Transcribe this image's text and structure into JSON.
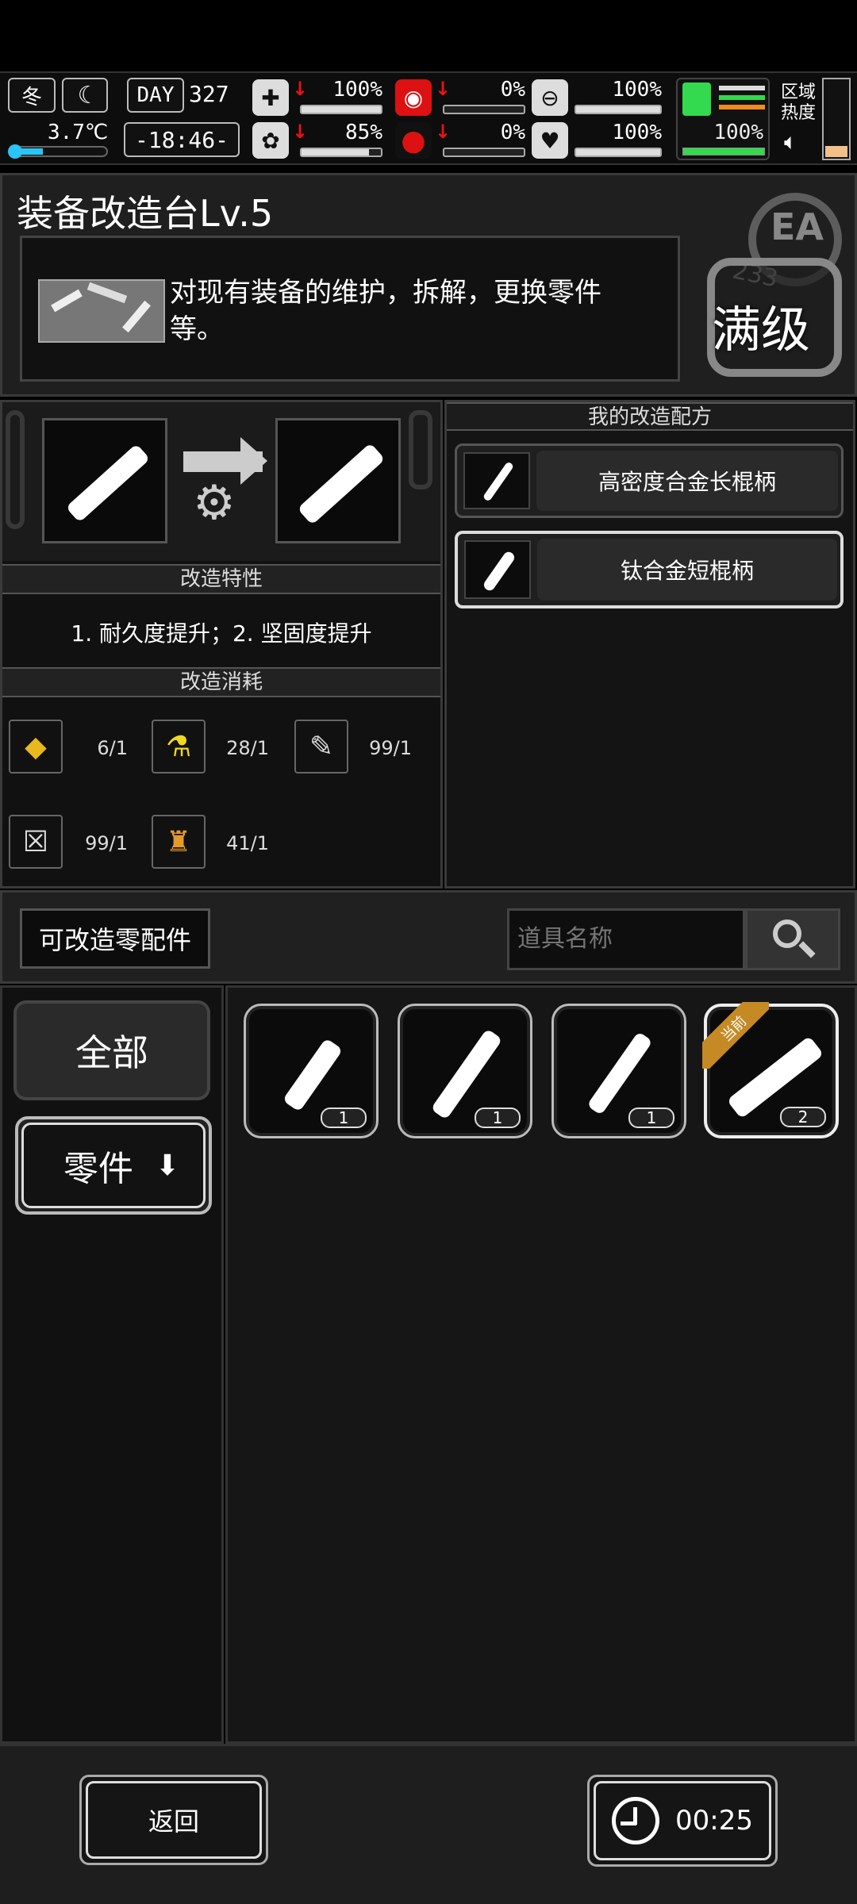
{
  "status": {
    "season": "冬",
    "day_label": "DAY",
    "day": "327",
    "temperature": "3.7℃",
    "time": "-18:46-",
    "stats": [
      {
        "name": "health",
        "value": "100%",
        "fraction": 1.0
      },
      {
        "name": "hunger",
        "value": "0%",
        "fraction": 0.0
      },
      {
        "name": "stomach",
        "value": "100%",
        "fraction": 1.0
      },
      {
        "name": "sanity",
        "value": "85%",
        "fraction": 0.85
      },
      {
        "name": "thirst",
        "value": "0%",
        "fraction": 0.0
      },
      {
        "name": "heart",
        "value": "100%",
        "fraction": 1.0
      }
    ],
    "stamina": "100%",
    "zone_heat_label_1": "区域",
    "zone_heat_label_2": "热度"
  },
  "title": {
    "name": "装备改造台Lv.5",
    "description": "对现有装备的维护，拆解，更换零件等。",
    "badge_top": "EA",
    "badge_mid": "233",
    "max_level": "满级"
  },
  "upgrade": {
    "traits_header": "改造特性",
    "traits_text": "1. 耐久度提升；2. 坚固度提升",
    "cost_header": "改造消耗",
    "costs": [
      {
        "icon": "fuel-icon",
        "value": "6/1"
      },
      {
        "icon": "flask-icon",
        "value": "28/1"
      },
      {
        "icon": "syringe-icon",
        "value": "99/1"
      },
      {
        "icon": "battery-icon",
        "value": "99/1"
      },
      {
        "icon": "potion-icon",
        "value": "41/1"
      }
    ]
  },
  "recipes": {
    "header": "我的改造配方",
    "items": [
      {
        "label": "高密度合金长棍柄"
      },
      {
        "label": "钛合金短棍柄"
      }
    ]
  },
  "parts": {
    "section_label": "可改造零配件",
    "search_placeholder": "道具名称",
    "filter_all": "全部",
    "filter_parts": "零件",
    "items": [
      {
        "count": "1"
      },
      {
        "count": "1"
      },
      {
        "count": "1"
      },
      {
        "count": "2",
        "tag": "当前"
      }
    ]
  },
  "footer": {
    "back": "返回",
    "timer": "00:25"
  }
}
